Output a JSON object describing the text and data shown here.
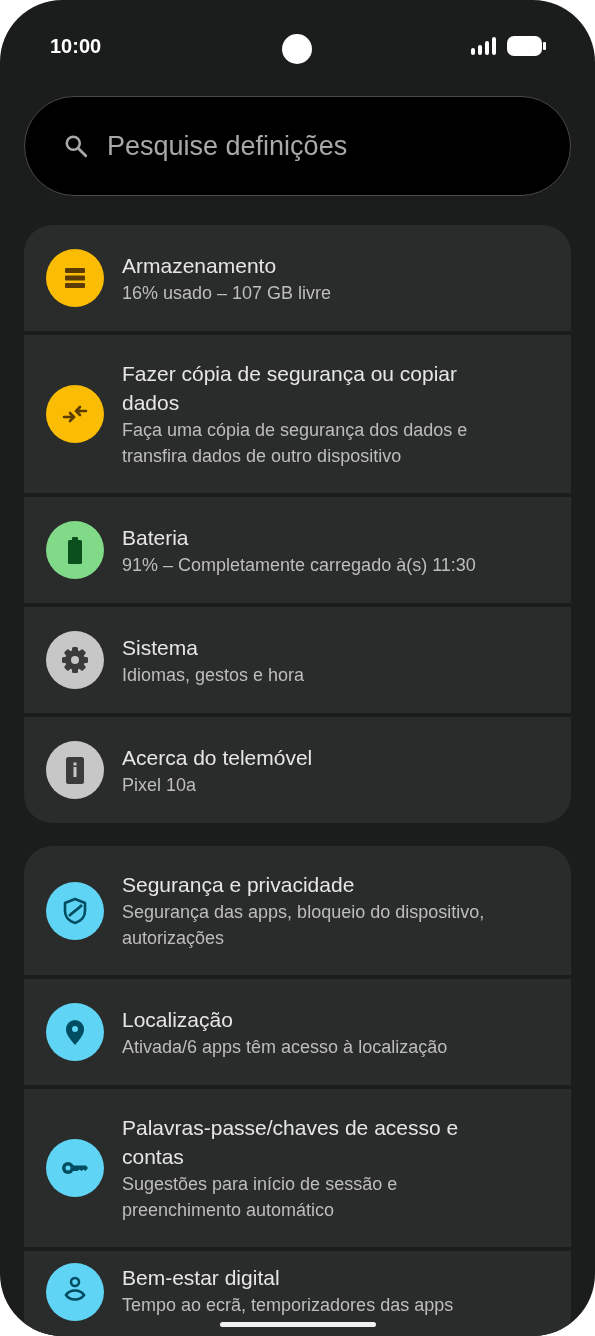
{
  "status_bar": {
    "time": "10:00"
  },
  "search": {
    "placeholder": "Pesquise definições"
  },
  "groups": [
    {
      "items": [
        {
          "kind": "storage",
          "color": "#fbbc04",
          "title": "Armazenamento",
          "subtitle": "16% usado – 107 GB livre"
        },
        {
          "kind": "transfer",
          "color": "#fbbc04",
          "title": "Fazer cópia de segurança ou copiar dados",
          "subtitle": "Faça uma cópia de segurança dos dados e transfira dados de outro dispositivo"
        },
        {
          "kind": "battery",
          "color": "#80da88",
          "title": "Bateria",
          "subtitle": "91% – Completamente carregado à(s) 11:30"
        },
        {
          "kind": "gear",
          "color": "#c7c7c7",
          "title": "Sistema",
          "subtitle": "Idiomas, gestos e hora"
        },
        {
          "kind": "phone",
          "color": "#c7c7c7",
          "title": "Acerca do telemóvel",
          "subtitle": "Pixel 10a"
        }
      ]
    },
    {
      "items": [
        {
          "kind": "shield",
          "color": "#5fd4f4",
          "title": "Segurança e privacidade",
          "subtitle": "Segurança das apps, bloqueio do dispositivo, autorizações"
        },
        {
          "kind": "pin",
          "color": "#5fd4f4",
          "title": "Localização",
          "subtitle": "Ativada/6 apps têm acesso à localização"
        },
        {
          "kind": "key",
          "color": "#5fd4f4",
          "title": "Palavras-passe/chaves de acesso e contas",
          "subtitle": "Sugestões para início de sessão e preenchimento automático"
        },
        {
          "kind": "wellbeing",
          "color": "#5fd4f4",
          "title": "Bem-estar digital",
          "subtitle": "Tempo ao ecrã, temporizadores das apps"
        }
      ]
    }
  ]
}
